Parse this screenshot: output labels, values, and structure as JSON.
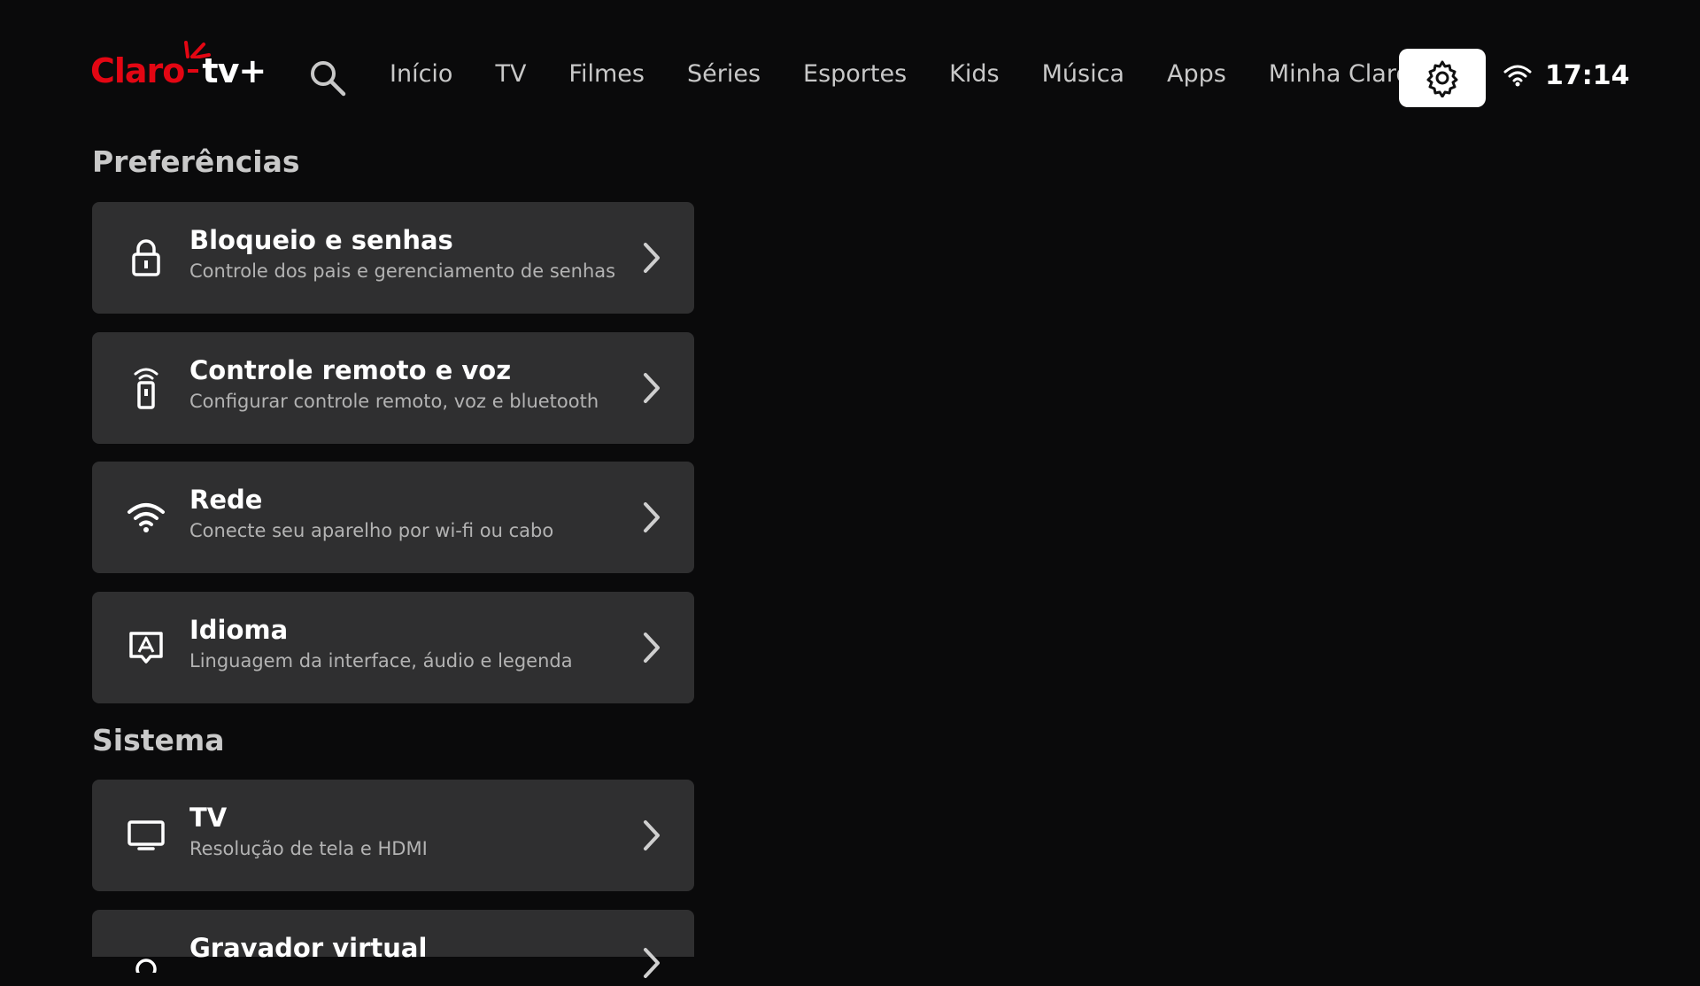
{
  "brand": {
    "part1": "Claro",
    "part2": "tv+"
  },
  "nav": {
    "items": [
      {
        "label": "Início"
      },
      {
        "label": "TV"
      },
      {
        "label": "Filmes"
      },
      {
        "label": "Séries"
      },
      {
        "label": "Esportes"
      },
      {
        "label": "Kids"
      },
      {
        "label": "Música"
      },
      {
        "label": "Apps"
      },
      {
        "label": "Minha Claro"
      }
    ]
  },
  "status": {
    "time": "17:14",
    "wifi_icon": "wifi-icon"
  },
  "sections": {
    "preferences": {
      "title": "Preferências",
      "items": [
        {
          "title": "Bloqueio e senhas",
          "subtitle": "Controle dos pais e gerenciamento de senhas",
          "icon": "lock-icon"
        },
        {
          "title": "Controle remoto e voz",
          "subtitle": "Configurar controle remoto, voz e bluetooth",
          "icon": "remote-icon"
        },
        {
          "title": "Rede",
          "subtitle": "Conecte seu aparelho por wi-fi ou cabo",
          "icon": "wifi-icon"
        },
        {
          "title": "Idioma",
          "subtitle": "Linguagem da interface, áudio e legenda",
          "icon": "language-icon"
        }
      ]
    },
    "system": {
      "title": "Sistema",
      "items": [
        {
          "title": "TV",
          "subtitle": "Resolução de tela e HDMI",
          "icon": "tv-icon"
        },
        {
          "title": "Gravador virtual",
          "subtitle": "",
          "icon": "recorder-icon"
        }
      ]
    }
  },
  "colors": {
    "brand_red": "#e30613",
    "card_bg": "#2f2f30",
    "background": "#0a0a0b"
  }
}
